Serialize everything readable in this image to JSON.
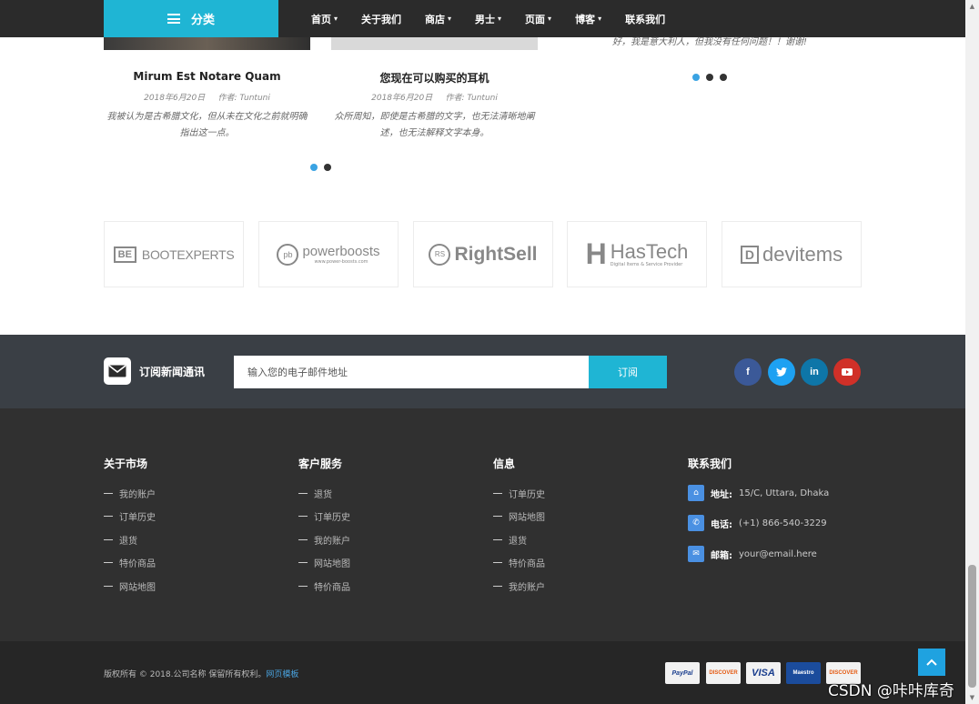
{
  "topnav": {
    "category_label": "分类",
    "items": [
      {
        "label": "首页",
        "has_dropdown": true
      },
      {
        "label": "关于我们",
        "has_dropdown": false
      },
      {
        "label": "商店",
        "has_dropdown": true
      },
      {
        "label": "男士",
        "has_dropdown": true
      },
      {
        "label": "页面",
        "has_dropdown": true
      },
      {
        "label": "博客",
        "has_dropdown": true
      },
      {
        "label": "联系我们",
        "has_dropdown": false
      }
    ]
  },
  "blog": {
    "cards": [
      {
        "title": "Mirum Est Notare Quam",
        "date": "2018年6月20日",
        "author": "作者: Tuntuni",
        "text": "我被认为是古希腊文化，但从未在文化之前就明确指出这一点。"
      },
      {
        "title": "您现在可以购买的耳机",
        "date": "2018年6月20日",
        "author": "作者: Tuntuni",
        "text": "众所周知，即使是古希腊的文字，也无法清晰地阐述，也无法解释文字本身。"
      }
    ],
    "testimonial_text": "好，我是意大利人，但我没有任何问题！！谢谢!"
  },
  "brands": [
    "BOOTEXPERTS",
    "powerboosts",
    "RightSell",
    "HasTech",
    "devitems"
  ],
  "brand_taglines": {
    "powerboosts": "www.power-boosts.com",
    "hastech": "Digital Items & Service Provider"
  },
  "newsletter": {
    "label": "订阅新闻通讯",
    "placeholder": "输入您的电子邮件地址",
    "button": "订阅"
  },
  "social": [
    {
      "icon": "facebook-icon",
      "glyph": "f",
      "color": "#3b5998"
    },
    {
      "icon": "twitter-icon",
      "glyph": "t",
      "color": "#1da1f2"
    },
    {
      "icon": "linkedin-icon",
      "glyph": "in",
      "color": "#0e76a8"
    },
    {
      "icon": "youtube-icon",
      "glyph": "▶",
      "color": "#d03028"
    }
  ],
  "footer": {
    "columns": [
      {
        "title": "关于市场",
        "links": [
          "我的账户",
          "订单历史",
          "退货",
          "特价商品",
          "网站地图"
        ]
      },
      {
        "title": "客户服务",
        "links": [
          "退货",
          "订单历史",
          "我的账户",
          "网站地图",
          "特价商品"
        ]
      },
      {
        "title": "信息",
        "links": [
          "订单历史",
          "网站地图",
          "退货",
          "特价商品",
          "我的账户"
        ]
      }
    ],
    "contact": {
      "title": "联系我们",
      "items": [
        {
          "label": "地址:",
          "value": "15/C, Uttara, Dhaka",
          "icon": "home-icon"
        },
        {
          "label": "电话:",
          "value": "(+1) 866-540-3229",
          "icon": "phone-icon"
        },
        {
          "label": "邮箱:",
          "value": "your@email.here",
          "icon": "envelope-icon"
        }
      ]
    }
  },
  "bottom": {
    "copyright": "版权所有 © 2018.公司名称 保留所有权利。",
    "link": "网页模板",
    "payments": [
      "PayPal",
      "DISCOVER",
      "VISA",
      "Maestro",
      "DISCOVER"
    ]
  },
  "watermark": "CSDN @咔咔库奇",
  "colors": {
    "accent": "#1fb5d4",
    "nav_bg": "#2b2b2b",
    "footer_bg": "#303030",
    "newsletter_bg": "#3a3f45"
  }
}
